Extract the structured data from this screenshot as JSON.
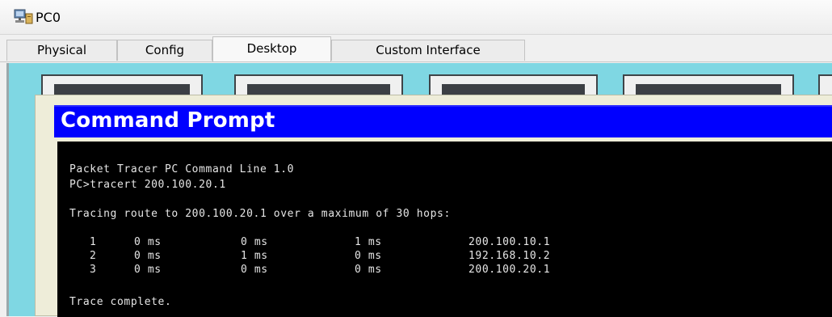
{
  "window": {
    "title": "PC0"
  },
  "tabs": [
    {
      "label": "Physical"
    },
    {
      "label": "Config"
    },
    {
      "label": "Desktop",
      "active": true
    },
    {
      "label": "Custom Interface"
    }
  ],
  "command_prompt": {
    "title": "Command Prompt",
    "banner": "Packet Tracer PC Command Line 1.0",
    "command": "PC>tracert 200.100.20.1",
    "tracing_line": "Tracing route to 200.100.20.1 over a maximum of 30 hops:",
    "hops": [
      {
        "hop": "1",
        "t1": "0 ms",
        "t2": "0 ms",
        "t3": "1 ms",
        "ip": "200.100.10.1"
      },
      {
        "hop": "2",
        "t1": "0 ms",
        "t2": "1 ms",
        "t3": "0 ms",
        "ip": "192.168.10.2"
      },
      {
        "hop": "3",
        "t1": "0 ms",
        "t2": "0 ms",
        "t3": "0 ms",
        "ip": "200.100.20.1"
      }
    ],
    "footer": "Trace complete."
  },
  "colors": {
    "desktop_bg": "#7fd7e3",
    "prompt_header": "#0000ff",
    "console_bg": "#000000",
    "console_text": "#e6e6e6"
  }
}
